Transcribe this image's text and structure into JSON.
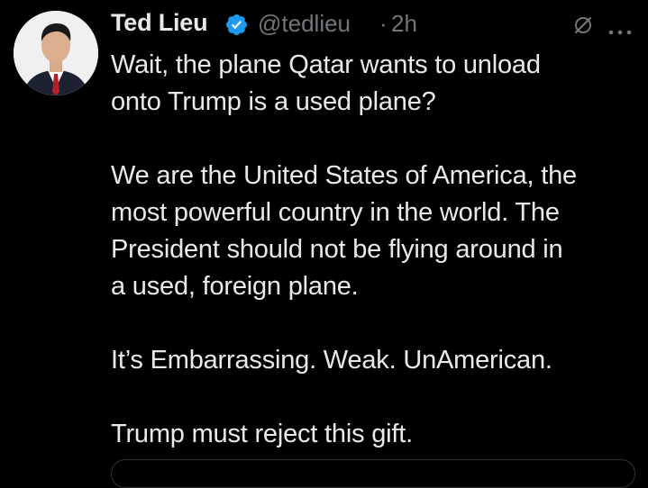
{
  "author": {
    "name": "Ted Lieu",
    "handle": "@tedlieu",
    "separator": "·",
    "time": "2h",
    "verified_icon": "verified-badge-icon",
    "verified_color": "#1d9bf0"
  },
  "tweet": {
    "lines": [
      "Wait, the plane Qatar wants to unload",
      "onto Trump is a used plane?",
      "We are the United States of America, the",
      "most powerful country in the world. The",
      "President should not be flying around in",
      "a used, foreign plane.",
      "It’s Embarrassing. Weak. UnAmerican.",
      "Trump must reject this gift."
    ]
  },
  "icons": {
    "grok": "grok-icon",
    "more": "more-options-icon"
  },
  "colors": {
    "background": "#000000",
    "text": "#e7e9ea",
    "secondary": "#71767b"
  }
}
